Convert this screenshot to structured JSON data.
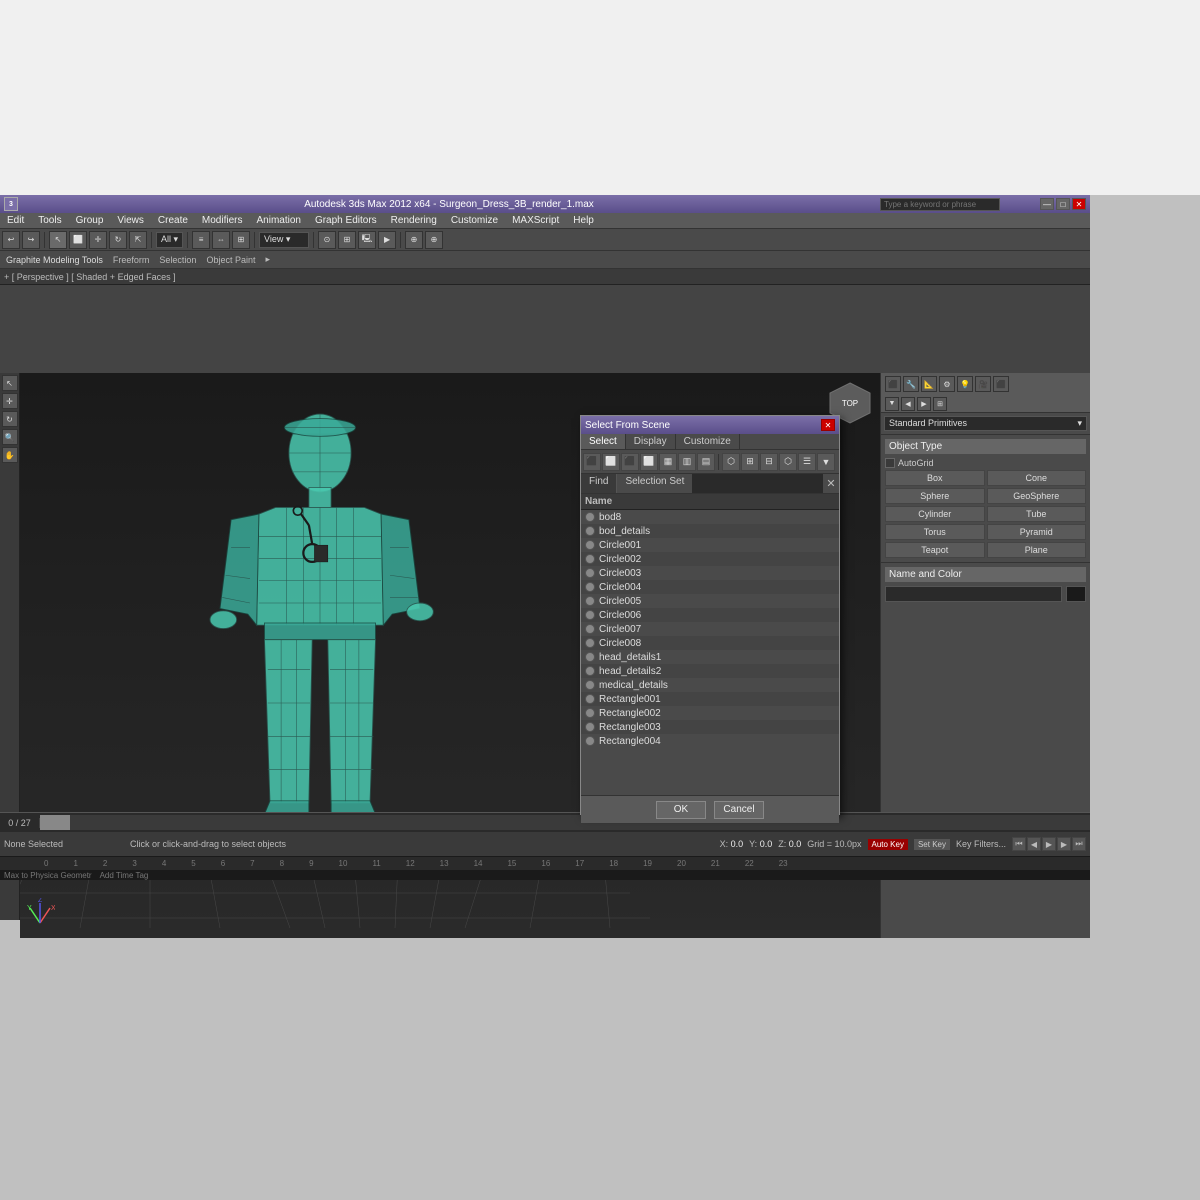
{
  "app": {
    "title": "Autodesk 3ds Max 2012 x64 - Surgeon_Dress_3B_render_1.max",
    "logo": "3dsmax-logo"
  },
  "titlebar": {
    "search_placeholder": "Type a keyword or phrase",
    "minimize": "—",
    "maximize": "□",
    "close": "✕"
  },
  "menubar": {
    "items": [
      "Edit",
      "Tools",
      "Group",
      "Views",
      "Create",
      "Modifiers",
      "Animation",
      "Graph Editors",
      "Rendering",
      "Customize",
      "MAXScript",
      "Help"
    ]
  },
  "toolbar2": {
    "items": [
      "Graphite Modeling Tools",
      "Freeform",
      "Selection",
      "Object Paint"
    ]
  },
  "viewport": {
    "label": "+ [ Perspective ] [ Shaded + Edged Faces ]"
  },
  "rightpanel": {
    "primitives_label": "Standard Primitives",
    "object_type_label": "Object Type",
    "autogrid_label": "AutoGrid",
    "objects": [
      "Box",
      "Cone",
      "Sphere",
      "GeoSphere",
      "Cylinder",
      "Tube",
      "Torus",
      "Pyramid",
      "Teapot",
      "Plane"
    ],
    "name_color_label": "Name and Color"
  },
  "dialog": {
    "title": "Select From Scene",
    "close_btn": "✕",
    "tabs": [
      "Select",
      "Display",
      "Customize"
    ],
    "find_tab": "Find",
    "selset_tab": "Selection Set",
    "list_header": "Name",
    "items": [
      "bod8",
      "bod_details",
      "Circle001",
      "Circle002",
      "Circle003",
      "Circle004",
      "Circle005",
      "Circle006",
      "Circle007",
      "Circle008",
      "head_details1",
      "head_details2",
      "medical_details",
      "Rectangle001",
      "Rectangle002",
      "Rectangle003",
      "Rectangle004"
    ],
    "ok_label": "OK",
    "cancel_label": "Cancel"
  },
  "timeline": {
    "frame_info": "0 / 27"
  },
  "statusbar": {
    "selection": "None Selected",
    "hint": "Click or click-and-drag to select objects",
    "coords": "X: 0.0, Y: 0.0, Z: 0.0",
    "grid": "Grid = 10.0px",
    "autokey": "Auto Key",
    "setkey": "Set Key",
    "keyfilters": "Key Filters..."
  },
  "colors": {
    "titlebar_grad_top": "#7b6fa8",
    "titlebar_grad_bot": "#5a4e8a",
    "viewport_bg": "#1a1a1a",
    "figure_teal": "#4ac9b0",
    "figure_dark": "#2a8a7a",
    "grid_color": "#555555",
    "dialog_bg": "#5a5a5a"
  }
}
